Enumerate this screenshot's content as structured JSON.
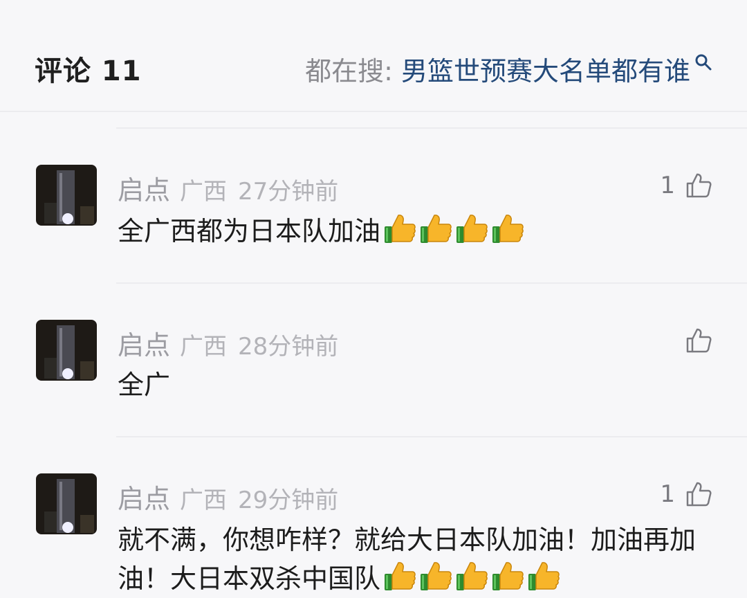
{
  "header": {
    "title": "评论 11",
    "search_prefix": "都在搜:",
    "search_query": "男篮世预赛大名单都有谁"
  },
  "comments": [
    {
      "name": "启点",
      "region": "广西",
      "time": "27分钟前",
      "likes": "1",
      "text": "全广西都为日本队加油",
      "emoji_count": 4
    },
    {
      "name": "启点",
      "region": "广西",
      "time": "28分钟前",
      "likes": "",
      "text": "全广",
      "emoji_count": 0
    },
    {
      "name": "启点",
      "region": "广西",
      "time": "29分钟前",
      "likes": "1",
      "text": "就不满，你想咋样？就给大日本队加油！加油再加油！大日本双杀中国队",
      "emoji_count": 5
    }
  ],
  "icons": {
    "search": "search-icon",
    "like": "thumbs-up-icon",
    "emoji": "thumbs-up-emoji"
  },
  "colors": {
    "accent": "#244a7a",
    "muted": "#9c9ca2",
    "background": "#f7f7f9"
  }
}
